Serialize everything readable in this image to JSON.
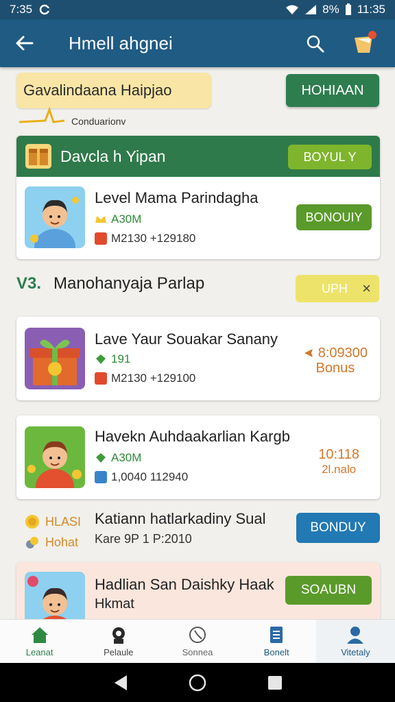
{
  "status_bar": {
    "time_left": "7:35",
    "battery_text": "8%",
    "time_right": "11:35"
  },
  "app_bar": {
    "title": "Hmell ahgnei"
  },
  "banner": {
    "title": "Gavalindaana Haipjao",
    "button": "HOHIAAN",
    "note": "Conduarionv"
  },
  "card1": {
    "header_title": "Davcla h Yipan",
    "header_button": "BOYUL Y",
    "row": {
      "name": "Level Mama Parindagha",
      "meta1": "A30M",
      "meta2": "M2130 +129180",
      "button": "BONOUIY"
    }
  },
  "section": {
    "number": "V3.",
    "title": "Manohanyaja Parlap",
    "chip": "UPH",
    "chip_close": "×"
  },
  "item1": {
    "name": "Lave Yaur Souakar Sanany",
    "meta1": "191",
    "meta2": "M2130 +129100",
    "bonus_value": "8:09300",
    "bonus_label": "Bonus"
  },
  "item2": {
    "name": "Havekn Auhdaakarlian Kargb",
    "meta1": "A30M",
    "meta2": "1,0040 112940",
    "time_value": "10:118",
    "time_label": "2l.nalo"
  },
  "plain_row": {
    "label1": "HLASI",
    "label2": "Hohat",
    "name": "Katiann hatlarkadiny Sual",
    "sub": "Kare 9P 1 P:2010",
    "button": "BONDUY"
  },
  "pink_card": {
    "name": "Hadlian San Daishky Haak",
    "sub": "Hkmat",
    "button": "SOAUBN"
  },
  "bottom_nav": [
    {
      "label": "Leanat",
      "icon": "home-icon"
    },
    {
      "label": "Pelaule",
      "icon": "profile-icon"
    },
    {
      "label": "Sonnea",
      "icon": "clock-icon"
    },
    {
      "label": "Bonelt",
      "icon": "document-icon"
    },
    {
      "label": "Vitetaly",
      "icon": "person-icon"
    }
  ],
  "colors": {
    "appbar": "#1f5b83",
    "green_header": "#2f7a4a",
    "accent_blue": "#2279b3",
    "accent_green": "#5a9a2a"
  }
}
